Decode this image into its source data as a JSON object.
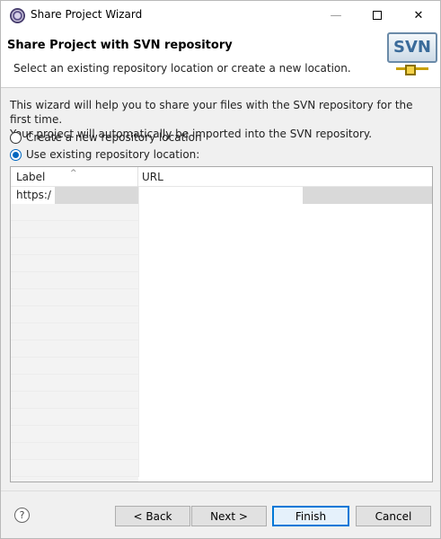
{
  "window": {
    "title": "Share Project Wizard",
    "minimize_glyph": "—",
    "close_glyph": "✕"
  },
  "header": {
    "title": "Share Project with SVN repository",
    "subtitle": "Select an existing repository location or create a new location.",
    "logo_text": "SVN"
  },
  "body": {
    "description_line1": "This wizard will help you to share your files with the SVN repository for the first time.",
    "description_line2": "Your project will automatically be imported into the SVN repository.",
    "option_new": "Create a new repository location",
    "option_existing": "Use existing repository location:",
    "selected_option": "existing"
  },
  "table": {
    "columns": [
      "Label",
      "URL"
    ],
    "rows": [
      {
        "label": "https:/",
        "url": ""
      }
    ]
  },
  "footer": {
    "help_glyph": "?",
    "back_label": "< Back",
    "next_label": "Next >",
    "finish_label": "Finish",
    "cancel_label": "Cancel"
  },
  "colors": {
    "accent": "#0067c0",
    "selection": "#d9d9d9"
  }
}
